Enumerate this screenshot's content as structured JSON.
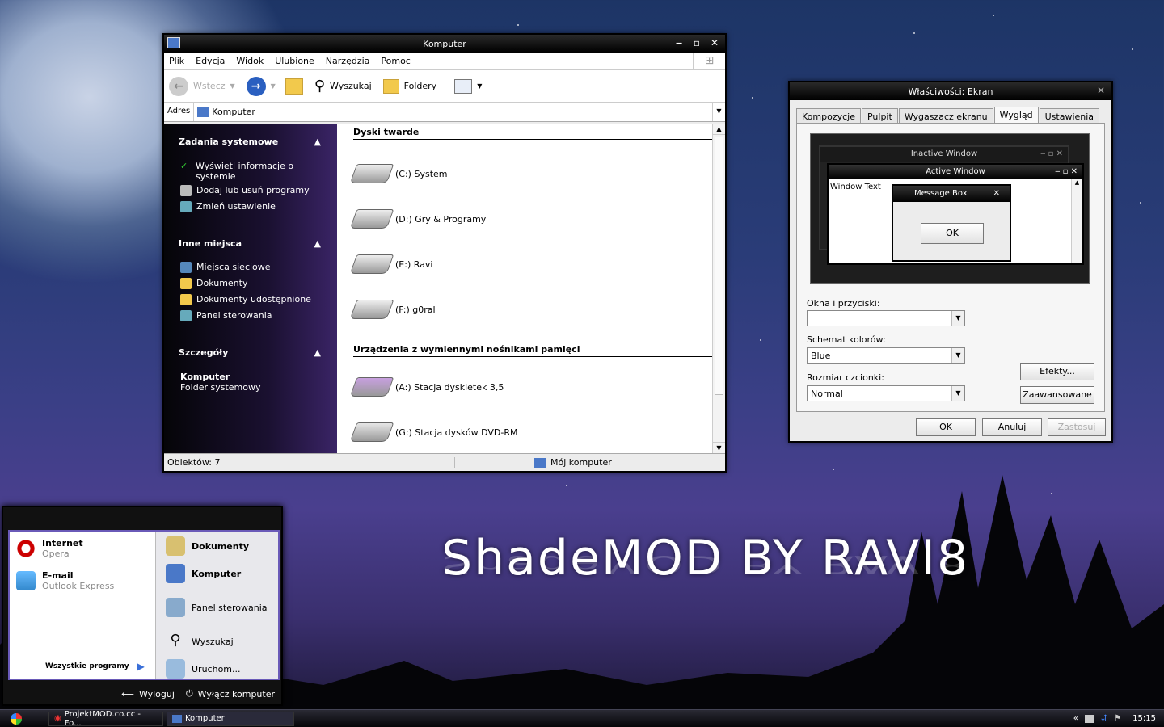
{
  "explorer": {
    "title": "Komputer",
    "menu": [
      "Plik",
      "Edycja",
      "Widok",
      "Ulubione",
      "Narzędzia",
      "Pomoc"
    ],
    "toolbar": {
      "back": "Wstecz",
      "search": "Wyszukaj",
      "folders": "Foldery"
    },
    "address": {
      "label": "Adres",
      "value": "Komputer"
    },
    "side": {
      "tasks_title": "Zadania systemowe",
      "tasks": [
        "Wyświetl informacje o systemie",
        "Dodaj lub usuń programy",
        "Zmień ustawienie"
      ],
      "places_title": "Inne miejsca",
      "places": [
        "Miejsca sieciowe",
        "Dokumenty",
        "Dokumenty udostępnione",
        "Panel sterowania"
      ],
      "details_title": "Szczegóły",
      "details_name": "Komputer",
      "details_type": "Folder systemowy"
    },
    "groups": {
      "hdd": "Dyski twarde",
      "removable": "Urządzenia z wymiennymi nośnikami pamięci"
    },
    "drives": [
      "(C:) System",
      "(D:) Gry & Programy",
      "(E:) Ravi",
      "(F:) g0ral"
    ],
    "removable": [
      "(A:) Stacja dyskietek 3,5",
      "(G:) Stacja dysków DVD-RM"
    ],
    "status": {
      "objects": "Obiektów: 7",
      "location": "Mój komputer"
    }
  },
  "display": {
    "title": "Właściwości: Ekran",
    "tabs": [
      "Kompozycje",
      "Pulpit",
      "Wygaszacz ekranu",
      "Wygląd",
      "Ustawienia"
    ],
    "preview": {
      "inactive": "Inactive Window",
      "active": "Active Window",
      "window_text": "Window Text",
      "msgbox": "Message Box",
      "ok": "OK"
    },
    "labels": {
      "windows": "Okna i przyciski:",
      "scheme": "Schemat kolorów:",
      "font": "Rozmiar czcionki:"
    },
    "values": {
      "windows": "",
      "scheme": "Blue",
      "font": "Normal"
    },
    "buttons": {
      "effects": "Efekty...",
      "advanced": "Zaawansowane",
      "ok": "OK",
      "cancel": "Anuluj",
      "apply": "Zastosuj"
    }
  },
  "startmenu": {
    "pinned": [
      {
        "title": "Internet",
        "sub": "Opera"
      },
      {
        "title": "E-mail",
        "sub": "Outlook Express"
      }
    ],
    "all_programs": "Wszystkie programy",
    "right": [
      "Dokumenty",
      "Komputer",
      "Panel sterowania",
      "Wyszukaj",
      "Uruchom..."
    ],
    "logoff": "Wyloguj",
    "shutdown": "Wyłącz komputer"
  },
  "taskbar": {
    "tasks": [
      "ProjektMOD.co.cc - Fo...",
      "Komputer"
    ],
    "clock": "15:15",
    "chevron": "«"
  },
  "banner": "ShadeMOD BY RAVI8"
}
